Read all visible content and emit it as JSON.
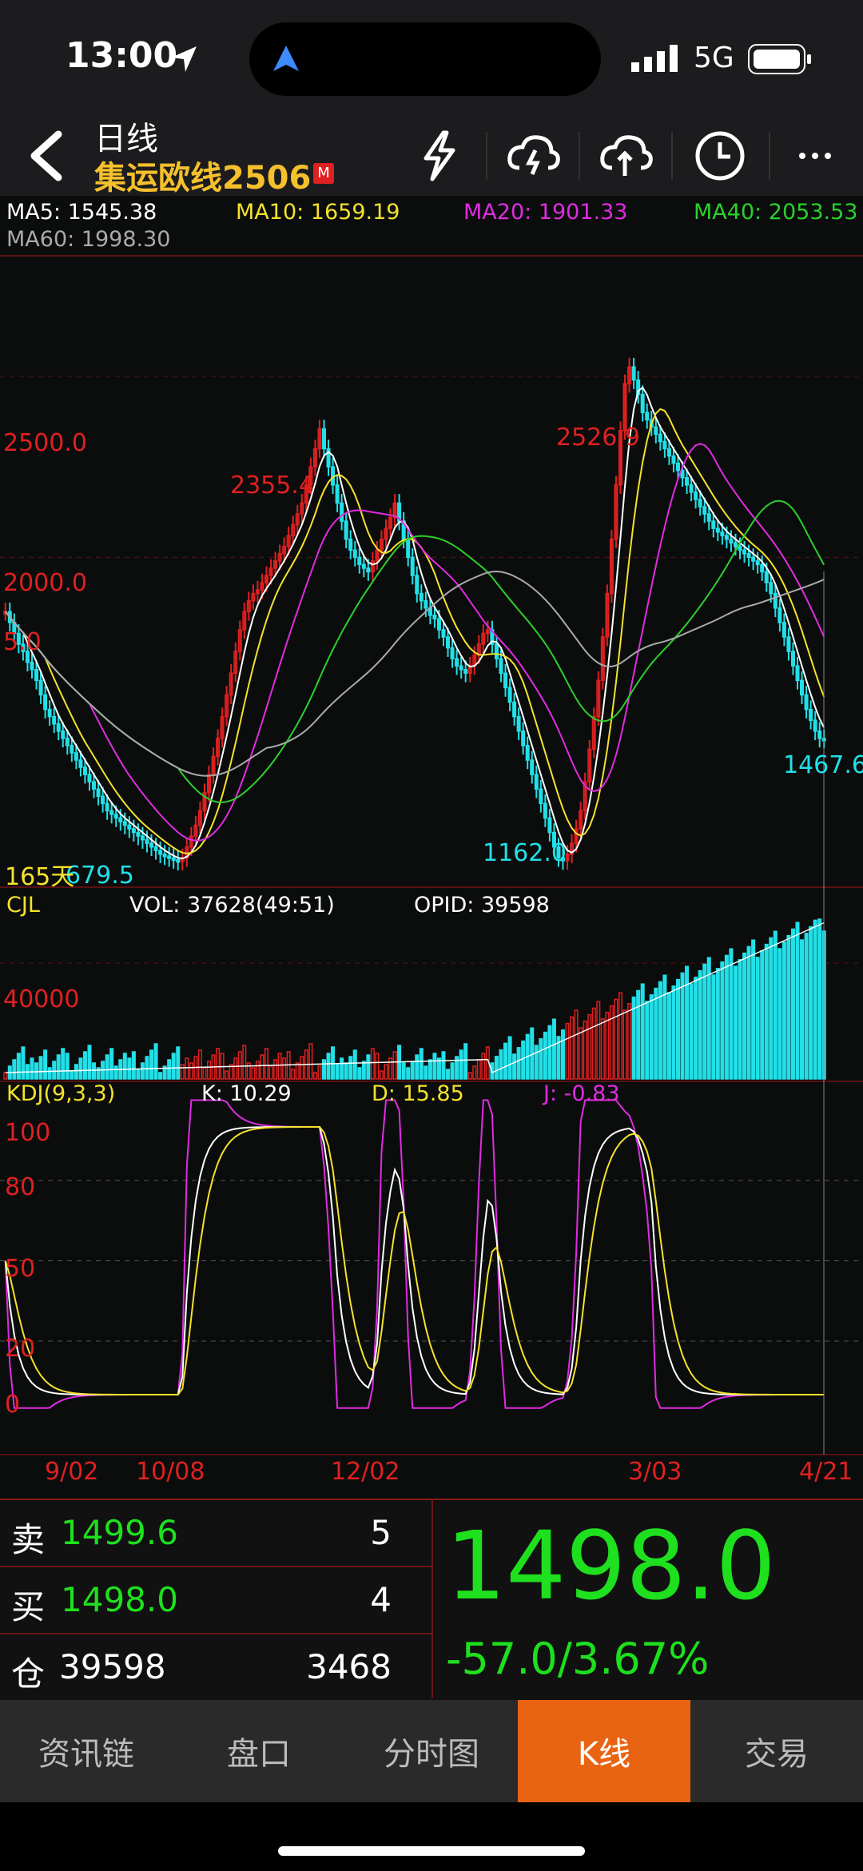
{
  "status": {
    "time": "13:00",
    "network": "5G"
  },
  "header": {
    "back_icon": "chevron-left-icon",
    "title": "日线",
    "symbol": "集运欧线2506",
    "badge": "M",
    "icons": [
      "lightning-icon",
      "cloud-download-icon",
      "cloud-upload-icon",
      "clock-icon",
      "more-icon"
    ]
  },
  "ma_legend": [
    {
      "label": "MA5: 1545.38",
      "color": "#ffffff"
    },
    {
      "label": "MA10: 1659.19",
      "color": "#f5e22c"
    },
    {
      "label": "MA20: 1901.33",
      "color": "#e02ce0"
    },
    {
      "label": "MA40: 2053.53",
      "color": "#2cd02c"
    },
    {
      "label": "MA60: 1998.30",
      "color": "#aaaaaa"
    }
  ],
  "price_panel": {
    "grid_labels": [
      "2500.0",
      "2000.0",
      "5.0"
    ],
    "annotations": {
      "high1": "2355.4",
      "high2": "2526.9",
      "low1": "1162.0",
      "low_left": "679.5",
      "last_low": "1467.6",
      "days": "165天"
    }
  },
  "volume_panel": {
    "name": "CJL",
    "vol": "VOL: 37628(49:51)",
    "opid": "OPID: 39598",
    "grid_label": "40000"
  },
  "kdj_panel": {
    "name": "KDJ(9,3,3)",
    "k": "K: 10.29",
    "d": "D: 15.85",
    "j": "J: -0.83",
    "levels": [
      "100",
      "80",
      "50",
      "20",
      "0"
    ]
  },
  "dates": [
    "9/02",
    "10/08",
    "12/02",
    "3/03",
    "4/21"
  ],
  "colors": {
    "up": "#e02020",
    "down": "#22e0e8",
    "ma5": "#ffffff",
    "ma10": "#f5e22c",
    "ma20": "#e02ce0",
    "ma40": "#2cd02c",
    "ma60": "#aaaaaa",
    "quote_green": "#1ee01e",
    "tab_active": "#e96412"
  },
  "chart_data": {
    "type": "candlestick",
    "ylim": [
      1100,
      2800
    ],
    "closes": [
      1850,
      1820,
      1790,
      1760,
      1740,
      1710,
      1690,
      1660,
      1620,
      1580,
      1560,
      1540,
      1520,
      1500,
      1480,
      1460,
      1440,
      1420,
      1400,
      1380,
      1360,
      1340,
      1320,
      1300,
      1290,
      1280,
      1270,
      1260,
      1250,
      1240,
      1230,
      1220,
      1210,
      1200,
      1190,
      1180,
      1175,
      1170,
      1165,
      1160,
      1170,
      1200,
      1230,
      1260,
      1300,
      1350,
      1400,
      1450,
      1500,
      1560,
      1620,
      1680,
      1740,
      1800,
      1850,
      1880,
      1900,
      1910,
      1930,
      1950,
      1970,
      1990,
      2010,
      2030,
      2060,
      2090,
      2120,
      2150,
      2200,
      2250,
      2300,
      2355,
      2300,
      2250,
      2200,
      2150,
      2100,
      2050,
      2020,
      2000,
      1980,
      1970,
      1960,
      1990,
      2020,
      2050,
      2080,
      2110,
      2150,
      2100,
      2050,
      2000,
      1950,
      1900,
      1880,
      1860,
      1840,
      1830,
      1800,
      1780,
      1750,
      1720,
      1700,
      1690,
      1680,
      1700,
      1730,
      1760,
      1790,
      1800,
      1760,
      1720,
      1680,
      1640,
      1600,
      1560,
      1520,
      1480,
      1440,
      1400,
      1360,
      1320,
      1280,
      1240,
      1200,
      1170,
      1162,
      1180,
      1210,
      1250,
      1300,
      1380,
      1470,
      1560,
      1660,
      1780,
      1900,
      2050,
      2200,
      2350,
      2480,
      2526,
      2490,
      2450,
      2400,
      2380,
      2360,
      2340,
      2320,
      2300,
      2280,
      2260,
      2240,
      2220,
      2200,
      2180,
      2160,
      2140,
      2120,
      2100,
      2080,
      2070,
      2060,
      2050,
      2040,
      2030,
      2020,
      2010,
      2000,
      1990,
      1980,
      1960,
      1930,
      1900,
      1860,
      1820,
      1780,
      1740,
      1700,
      1660,
      1620,
      1580,
      1550,
      1520,
      1500,
      1498
    ]
  },
  "quote": {
    "sell_label": "卖",
    "sell_price": "1499.6",
    "sell_qty": "5",
    "buy_label": "买",
    "buy_price": "1498.0",
    "buy_qty": "4",
    "oi_label": "仓",
    "oi_value": "39598",
    "oi_change": "3468",
    "last": "1498.0",
    "change": "-57.0/3.67%"
  },
  "tabs": [
    "资讯链",
    "盘口",
    "分时图",
    "K线",
    "交易"
  ],
  "active_tab": "K线"
}
